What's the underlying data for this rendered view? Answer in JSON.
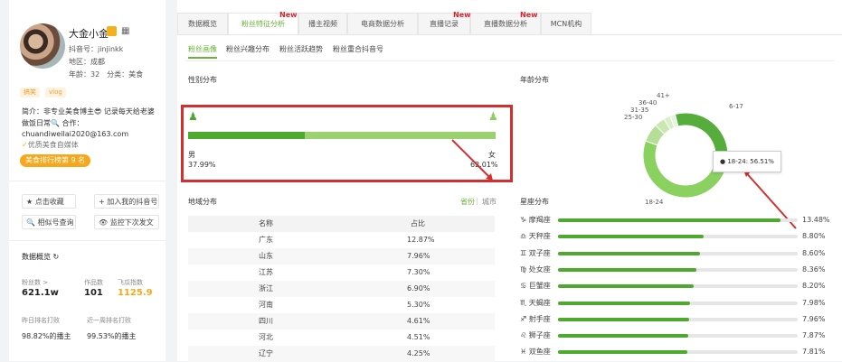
{
  "profile": {
    "name": "大金小金",
    "douyin_id": "抖音号：jinjinkk",
    "region": "地区：成都",
    "age_category": "年龄：32　分类：美食",
    "tags": [
      "搞笑",
      "vlog"
    ],
    "bio_1": "简介：非专业美食博主😎 记录每天给老婆",
    "bio_2": "做饭日常🔍 合作：",
    "bio_3": "chuandiweilai2020@163.com",
    "verified": "优质美食自媒体",
    "rank": "美食排行榜第 9 名",
    "actions": [
      "★ 点击收藏",
      "+ 加入我的抖音号",
      "🔍 相似号查询",
      "👁 监控下次发文"
    ],
    "overview_title": "数据概览",
    "stats": [
      {
        "label": "粉丝数 >",
        "value": "621.1w"
      },
      {
        "label": "作品数",
        "value": "101"
      },
      {
        "label": "飞瓜指数",
        "value": "1125.9"
      }
    ],
    "rank_stats": [
      {
        "label": "昨日排名打败",
        "value": "98.82%的播主"
      },
      {
        "label": "近一周排名打败",
        "value": "99.53%的播主"
      }
    ]
  },
  "tabs": [
    {
      "label": "数据概览",
      "new": ""
    },
    {
      "label": "粉丝特征分析",
      "new": "New"
    },
    {
      "label": "播主视频",
      "new": ""
    },
    {
      "label": "电商数据分析",
      "new": ""
    },
    {
      "label": "直播记录",
      "new": "New"
    },
    {
      "label": "直播数据分析",
      "new": "New"
    },
    {
      "label": "MCN机构",
      "new": ""
    }
  ],
  "subtabs": [
    "粉丝画像",
    "粉丝兴趣分布",
    "粉丝活跃趋势",
    "粉丝重合抖音号"
  ],
  "gender": {
    "title": "性别分布",
    "male_label": "男",
    "male_pct": "37.99%",
    "female_label": "女",
    "female_pct": "62.01%",
    "male_fraction": 0.3799
  },
  "age": {
    "title": "年龄分布",
    "tooltip": "● 18-24: 56.51%",
    "segments": [
      {
        "label": "18-24",
        "value": 56.51,
        "color": "#8ad160"
      },
      {
        "label": "6-17",
        "value": 28.0,
        "color": "#56ad3c"
      },
      {
        "label": "25-30",
        "value": 7.0,
        "color": "#b5df96"
      },
      {
        "label": "31-35",
        "value": 4.0,
        "color": "#c9e8b1"
      },
      {
        "label": "36-40",
        "value": 2.5,
        "color": "#d8eec8"
      },
      {
        "label": "41+",
        "value": 2.0,
        "color": "#e6f4dc"
      }
    ]
  },
  "region": {
    "title": "地域分布",
    "toggle_province": "省份",
    "toggle_city": "城市",
    "col_name": "名称",
    "col_pct": "占比",
    "rows": [
      {
        "name": "广东",
        "pct": "12.87%"
      },
      {
        "name": "山东",
        "pct": "7.96%"
      },
      {
        "name": "江苏",
        "pct": "7.30%"
      },
      {
        "name": "浙江",
        "pct": "6.90%"
      },
      {
        "name": "河南",
        "pct": "5.30%"
      },
      {
        "name": "四川",
        "pct": "4.61%"
      },
      {
        "name": "河北",
        "pct": "4.51%"
      },
      {
        "name": "辽宁",
        "pct": "4.25%"
      }
    ]
  },
  "zodiac": {
    "title": "星座分布",
    "rows": [
      {
        "name": "♑ 摩羯座",
        "pct": "13.48%",
        "value": 13.48
      },
      {
        "name": "♎ 天秤座",
        "pct": "8.80%",
        "value": 8.8
      },
      {
        "name": "♊ 双子座",
        "pct": "8.60%",
        "value": 8.6
      },
      {
        "name": "♍ 处女座",
        "pct": "8.36%",
        "value": 8.36
      },
      {
        "name": "♋ 巨蟹座",
        "pct": "8.20%",
        "value": 8.2
      },
      {
        "name": "♏ 天蝎座",
        "pct": "7.98%",
        "value": 7.98
      },
      {
        "name": "♐ 射手座",
        "pct": "7.96%",
        "value": 7.96
      },
      {
        "name": "♌ 狮子座",
        "pct": "7.87%",
        "value": 7.87
      },
      {
        "name": "♓ 双鱼座",
        "pct": "7.81%",
        "value": 7.81
      }
    ]
  },
  "colors": {
    "accent": "#6bb23a",
    "bar": "#4daa2e",
    "highlight": "#d32f2f"
  }
}
